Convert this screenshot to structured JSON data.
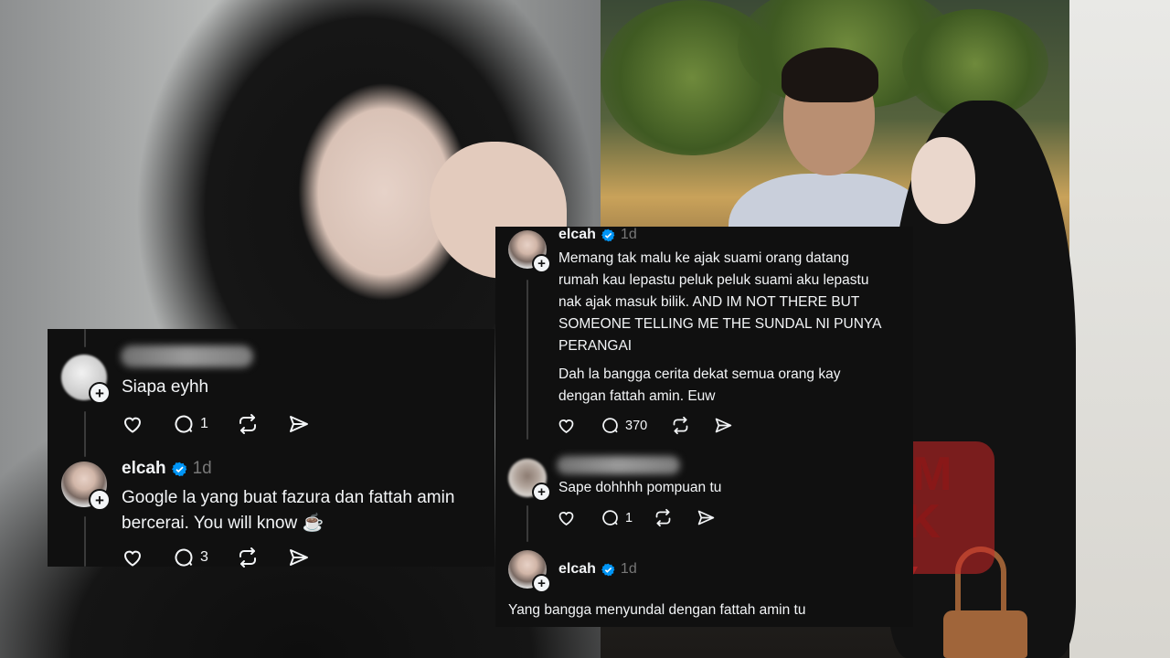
{
  "watermark": {
    "line1": "GEM",
    "line2": "PAK",
    "color": "#d02727"
  },
  "colors": {
    "card_bg": "#101010",
    "text": "#f3f5f7",
    "muted": "#777777",
    "verified": "#0095f6"
  },
  "left_panel": {
    "comments": [
      {
        "username": "",
        "text": "Siapa eyhh",
        "likes": "",
        "replies": "1"
      },
      {
        "username": "elcah",
        "time": "1d",
        "text_line1": "Google la yang buat fazura dan fattah amin",
        "text_line2": "bercerai. You will know ☕",
        "likes": "",
        "replies": "3"
      }
    ]
  },
  "right_panel": {
    "post": {
      "username": "elcah",
      "time": "1d",
      "lines": [
        "Memang tak malu ke ajak suami orang datang",
        "rumah kau lepastu peluk peluk suami aku lepastu",
        "nak ajak masuk bilik. AND IM NOT THERE BUT",
        "SOMEONE TELLING ME THE SUNDAL NI PUNYA",
        "PERANGAI"
      ],
      "lines2": [
        "Dah la bangga cerita dekat semua orang kay",
        "dengan fattah amin. Euw"
      ],
      "replies": "370"
    },
    "reply": {
      "username": "",
      "text": "Sape dohhhh pompuan tu",
      "replies": "1"
    },
    "reply2": {
      "username": "elcah",
      "time": "1d",
      "text": "Yang bangga menyundal dengan fattah amin tu"
    }
  },
  "icons": [
    "heart-icon",
    "comment-icon",
    "repost-icon",
    "share-icon",
    "verified-icon",
    "plus-icon"
  ]
}
